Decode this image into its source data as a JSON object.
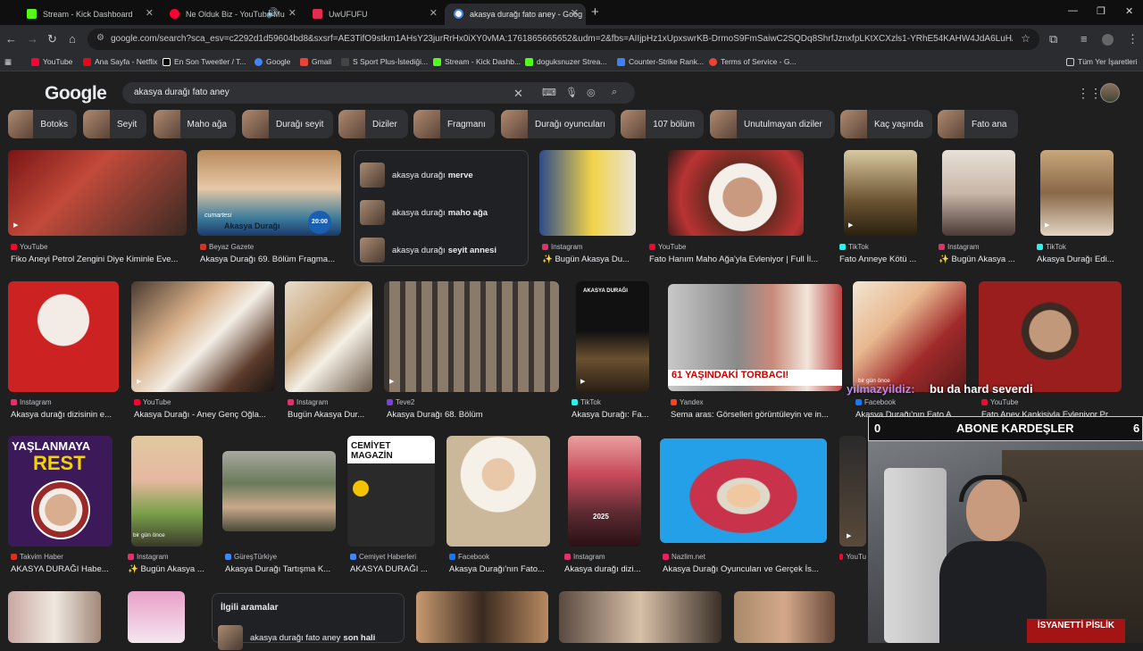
{
  "tabs": [
    {
      "title": "Stream - Kick Dashboard",
      "color": "#53fc18",
      "active": false
    },
    {
      "title": "Ne Olduk Biz - YouTube Mu",
      "color": "#ff0033",
      "active": false
    },
    {
      "title": "UwUFUFU",
      "color": "#e52b50",
      "active": false
    },
    {
      "title": "akasya durağı fato aney - Goog",
      "color": "#4285f4",
      "active": true
    }
  ],
  "address": {
    "url": "google.com/search?sca_esv=c2292d1d59604bd8&sxsrf=AE3TifO9stkm1AHsY23jurRrHx0iXY0vMA:1761865665652&udm=2&fbs=AIIjpHz1xUpxswrKB-DrmoS9FmSaiwC2SQDq8ShrfJznxfpLKtXCXzls1-YRhE54KAHW4JdA6LuHAwMuS0bINhUQAL..."
  },
  "bookmarks": [
    {
      "label": "YouTube",
      "color": "#ff0033"
    },
    {
      "label": "Ana Sayfa - Netflix",
      "color": "#e50914"
    },
    {
      "label": "En Son Tweetler / T...",
      "color": "#ffffff"
    },
    {
      "label": "Google",
      "color": "#4285f4"
    },
    {
      "label": "Gmail",
      "color": "#ea4335"
    },
    {
      "label": "S Sport Plus-İstediği...",
      "color": "#333333"
    },
    {
      "label": "Stream - Kick Dashb...",
      "color": "#53fc18"
    },
    {
      "label": "doguksnuzer Strea...",
      "color": "#53fc18"
    },
    {
      "label": "Counter-Strike Rank...",
      "color": "#3b82f6"
    },
    {
      "label": "Terms of Service - G...",
      "color": "#ea4335"
    }
  ],
  "bookmarks_right": "Tüm Yer İşaretleri",
  "google": {
    "logo": "Google",
    "query": "akasya durağı fato aney"
  },
  "chips": [
    "Botoks",
    "Seyit",
    "Maho ağa",
    "Durağı seyit",
    "Diziler",
    "Fragmanı",
    "Durağı oyuncuları",
    "107 bölüm",
    "Unutulmayan diziler",
    "Kaç yaşında",
    "Fato ana"
  ],
  "row1": [
    {
      "source": "YouTube",
      "caption": "Fiko Aneyi Petrol Zengini Diye Kiminle Eve...",
      "scolor": "#ff0033"
    },
    {
      "source": "Beyaz Gazete",
      "caption": "Akasya Durağı 69. Bölüm Fragma...",
      "scolor": "#d93025"
    },
    {
      "source": "Instagram",
      "caption": "✨ Bugün Akasya Du...",
      "scolor": "#e1306c"
    },
    {
      "source": "YouTube",
      "caption": "Fato Hanım Maho Ağa'yla Evleniyor | Full İl...",
      "scolor": "#ff0033"
    },
    {
      "source": "TikTok",
      "caption": "Fato Anneye Kötü ...",
      "scolor": "#25f4ee"
    },
    {
      "source": "Instagram",
      "caption": "✨ Bugün Akasya ...",
      "scolor": "#e1306c"
    },
    {
      "source": "TikTok",
      "caption": "Akasya Durağı Edi...",
      "scolor": "#25f4ee"
    }
  ],
  "thumb_texts": {
    "cumartesi": "cumartesi",
    "time": "20:00",
    "akasya": "Akasya Durağı",
    "card_akasya": "AKASYA DURAĞI",
    "torbaci": "61 YAŞINDAKİ TORBACI!",
    "yaslanmaya": "YAŞLANMAYA",
    "rest": "REST",
    "cemiyet": "CEMİYET MAGAZİN",
    "year": "2025",
    "biron": "bir gün önce"
  },
  "related": {
    "items": [
      {
        "prefix": "akasya durağı",
        "bold": "merve"
      },
      {
        "prefix": "akasya durağı",
        "bold": "maho ağa"
      },
      {
        "prefix": "akasya durağı",
        "bold": "seyit annesi"
      }
    ]
  },
  "row2": [
    {
      "source": "Instagram",
      "caption": "Akasya durağı dizisinin e...",
      "scolor": "#e1306c"
    },
    {
      "source": "YouTube",
      "caption": "Akasya Durağı - Aney Genç Oğla...",
      "scolor": "#ff0033"
    },
    {
      "source": "Instagram",
      "caption": "Bugün Akasya Dur...",
      "scolor": "#e1306c"
    },
    {
      "source": "Teve2",
      "caption": "Akasya Durağı 68. Bölüm",
      "scolor": "#7b3fe4"
    },
    {
      "source": "TikTok",
      "caption": "Akasya Durağı: Fa...",
      "scolor": "#25f4ee"
    },
    {
      "source": "Yandex",
      "caption": "Sema aras: Görselleri görüntüleyin ve in...",
      "scolor": "#fc3f1d"
    },
    {
      "source": "Facebook",
      "caption": "Akasya Durağı'nın Fato A...",
      "scolor": "#1877f2"
    },
    {
      "source": "YouTube",
      "caption": "Fato Aney Kankisiyla Evleniyor Pr...",
      "scolor": "#ff0033"
    }
  ],
  "row3": [
    {
      "source": "Takvim Haber",
      "caption": "AKASYA DURAĞI Habe...",
      "scolor": "#d93025"
    },
    {
      "source": "Instagram",
      "caption": "✨ Bugün Akasya ...",
      "scolor": "#e1306c"
    },
    {
      "source": "GüreşTürkiye",
      "caption": "Akasya Durağı Tartışma K...",
      "scolor": "#4285f4"
    },
    {
      "source": "Cemiyet Haberleri",
      "caption": "AKASYA DURAĞI ...",
      "scolor": "#4285f4"
    },
    {
      "source": "Facebook",
      "caption": "Akasya Durağı'nın Fato...",
      "scolor": "#1877f2"
    },
    {
      "source": "Instagram",
      "caption": "Akasya durağı dizi...",
      "scolor": "#e1306c"
    },
    {
      "source": "Nazlim.net",
      "caption": "Akasya Durağı Oyuncuları ve Gerçek İs...",
      "scolor": "#e91e63"
    },
    {
      "source": "YouTu",
      "caption": "",
      "scolor": "#ff0033"
    }
  ],
  "related_bottom": {
    "title": "İlgili aramalar",
    "item_prefix": "akasya durağı fato aney",
    "item_bold": "son hali"
  },
  "overlay": {
    "chat_user": "yilmazyildiz:",
    "chat_msg": "bu da hard severdi",
    "sub_left": "0",
    "sub_text": "ABONE KARDEŞLER",
    "sub_right": "6",
    "stamp": "İSYANETTİ PİSLİK"
  }
}
